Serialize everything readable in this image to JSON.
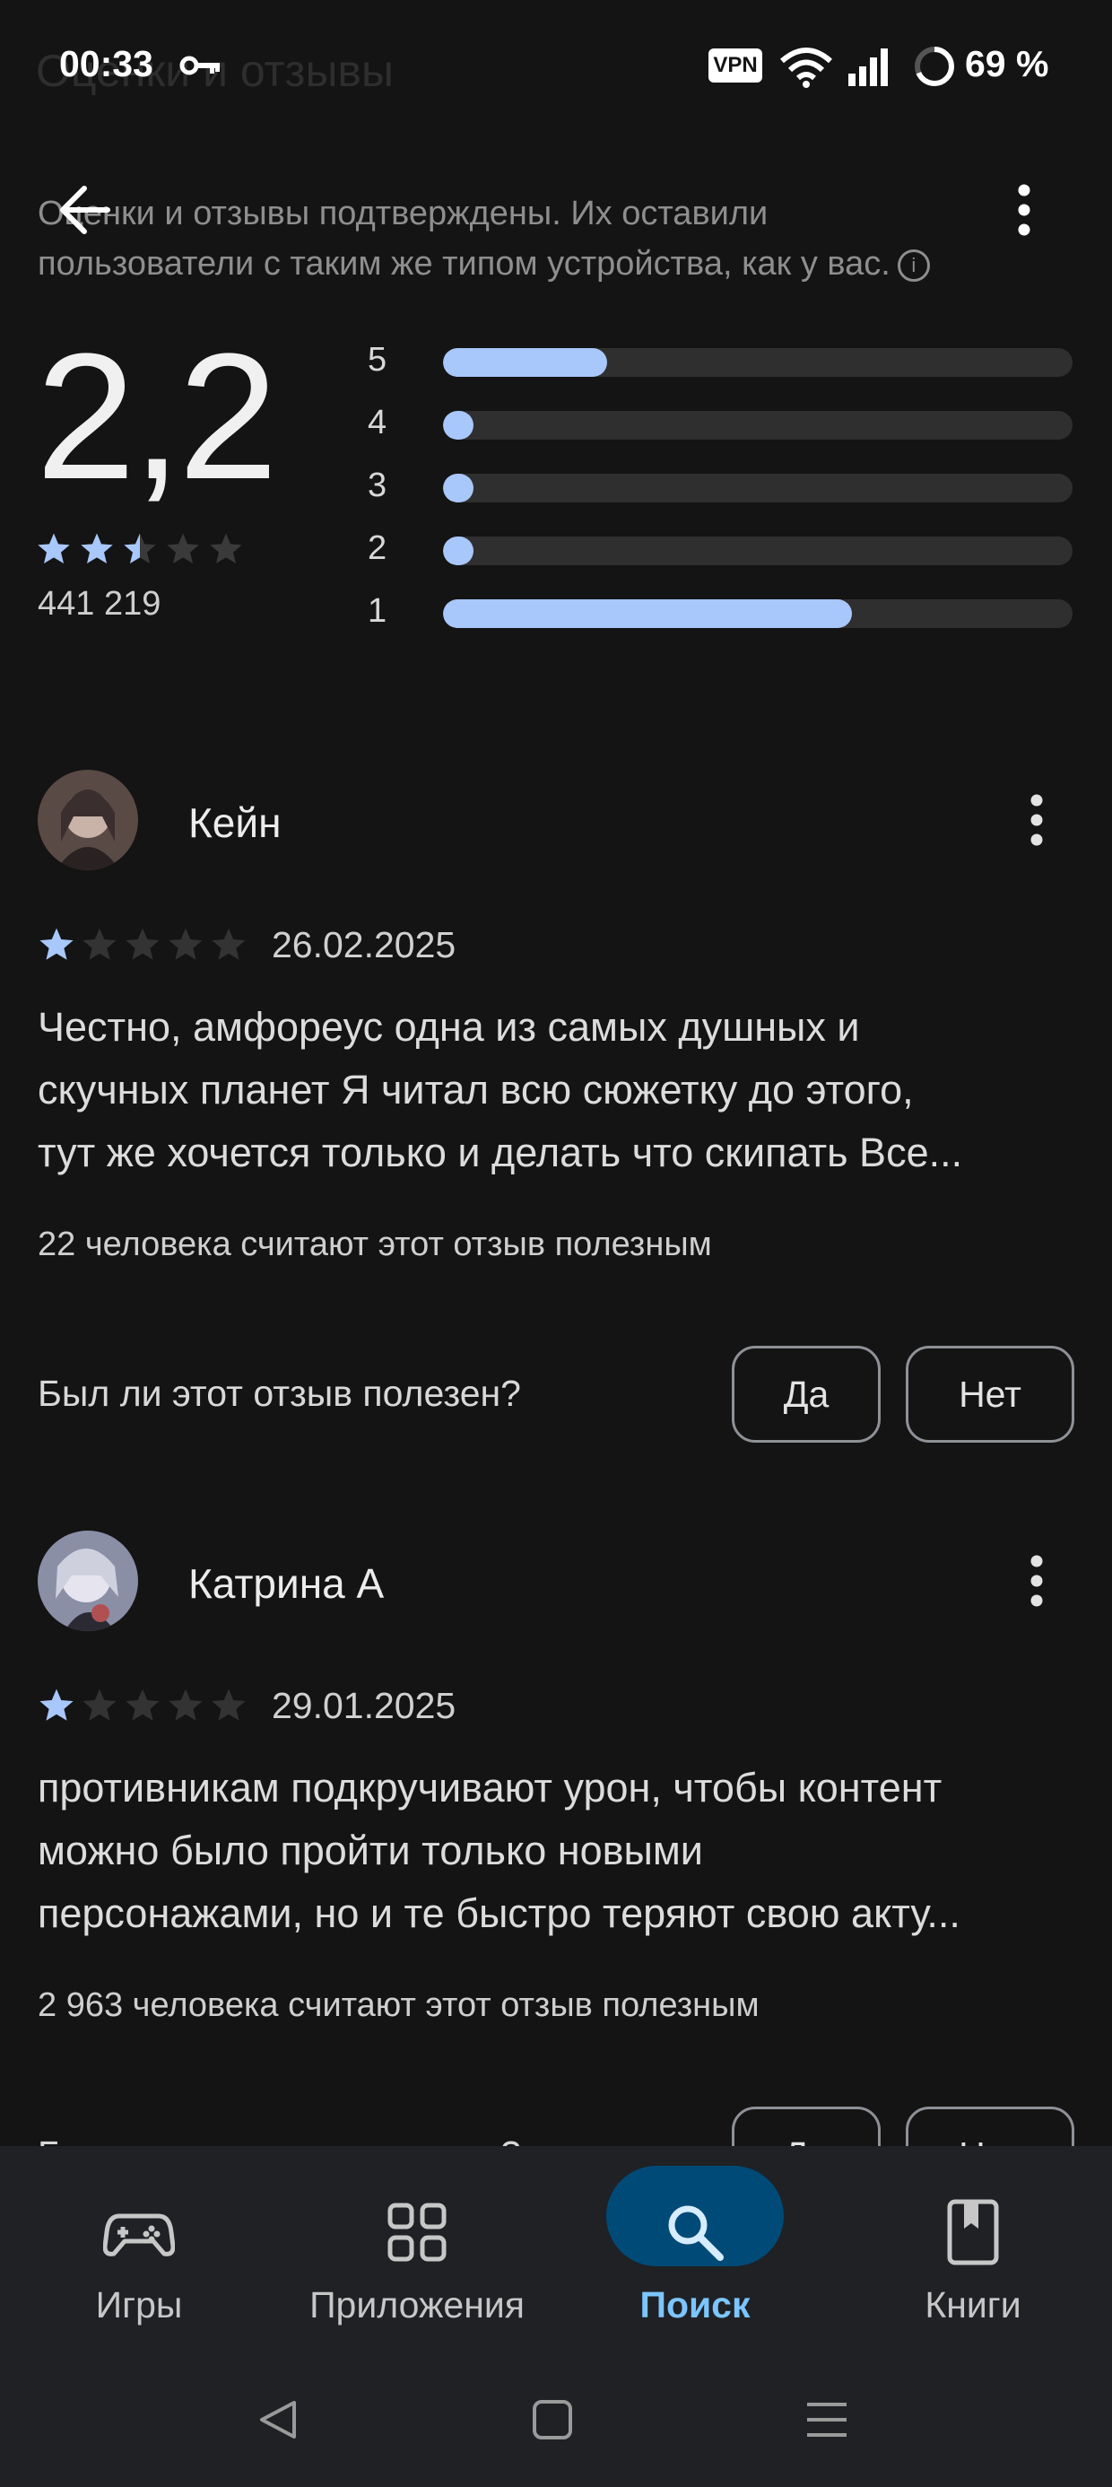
{
  "status_bar": {
    "time": "00:33",
    "battery_percent": "69 %",
    "vpn_label": "VPN"
  },
  "header": {
    "ghost_title": "Оценки и отзывы",
    "notice_line1": "Оценки и отзывы подтверждены. Их оставили",
    "notice_line2": "пользователи с таким же типом устройства, как у вас."
  },
  "rating_summary": {
    "average": "2,2",
    "stars_value": 2.5,
    "count": "441 219",
    "histogram": [
      {
        "label": "5",
        "fraction": 0.26
      },
      {
        "label": "4",
        "fraction": 0.04
      },
      {
        "label": "3",
        "fraction": 0.04
      },
      {
        "label": "2",
        "fraction": 0.04
      },
      {
        "label": "1",
        "fraction": 0.65
      }
    ]
  },
  "reviews": [
    {
      "author": "Кейн",
      "stars": 1,
      "date": "26.02.2025",
      "text_lines": [
        "Честно, амфореус одна из самых душных и",
        "скучных планет Я читал всю сюжетку до этого,",
        "тут же хочется только и делать что скипать Все..."
      ],
      "helpful": "22 человека считают этот отзыв полезным",
      "question": "Был ли этот отзыв полезен?",
      "yes": "Да",
      "no": "Нет"
    },
    {
      "author": "Катрина А",
      "stars": 1,
      "date": "29.01.2025",
      "text_lines": [
        "противникам подкручивают урон, чтобы контент",
        "можно было пройти только новыми",
        "персонажами, но и те быстро теряют свою акту..."
      ],
      "helpful": "2 963 человека считают этот отзыв полезным",
      "question": "Был ли этот отзыв полезен?",
      "yes": "Да",
      "no": "Нет"
    }
  ],
  "bottom_nav": {
    "items": [
      {
        "label": "Игры",
        "icon": "gamepad-icon",
        "active": false
      },
      {
        "label": "Приложения",
        "icon": "apps-grid-icon",
        "active": false
      },
      {
        "label": "Поиск",
        "icon": "search-icon",
        "active": true
      },
      {
        "label": "Книги",
        "icon": "book-icon",
        "active": false
      }
    ]
  },
  "colors": {
    "background": "#141414",
    "accent": "#a8c7fa",
    "active_pill": "#004a77",
    "active_label": "#7cc5ff"
  }
}
